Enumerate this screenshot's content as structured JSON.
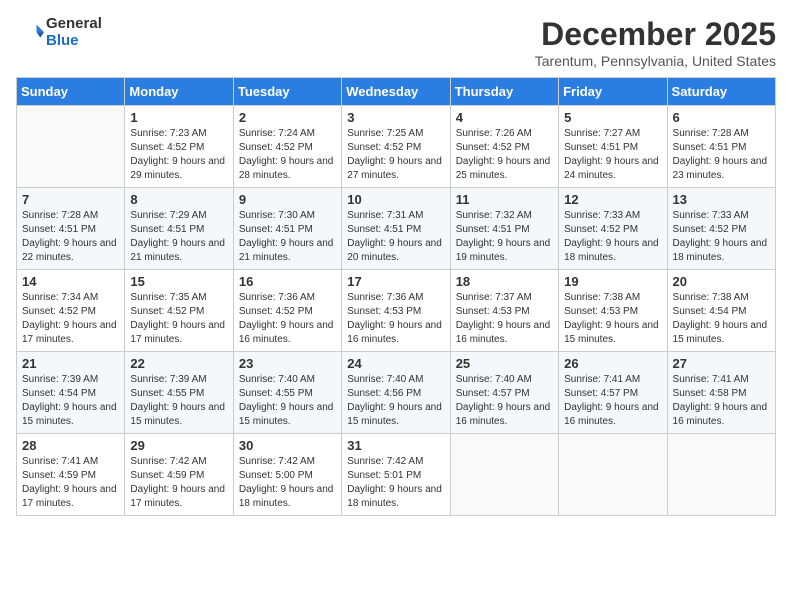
{
  "logo": {
    "general": "General",
    "blue": "Blue"
  },
  "header": {
    "month": "December 2025",
    "location": "Tarentum, Pennsylvania, United States"
  },
  "weekdays": [
    "Sunday",
    "Monday",
    "Tuesday",
    "Wednesday",
    "Thursday",
    "Friday",
    "Saturday"
  ],
  "weeks": [
    [
      {
        "day": "",
        "sunrise": "",
        "sunset": "",
        "daylight": ""
      },
      {
        "day": "1",
        "sunrise": "Sunrise: 7:23 AM",
        "sunset": "Sunset: 4:52 PM",
        "daylight": "Daylight: 9 hours and 29 minutes."
      },
      {
        "day": "2",
        "sunrise": "Sunrise: 7:24 AM",
        "sunset": "Sunset: 4:52 PM",
        "daylight": "Daylight: 9 hours and 28 minutes."
      },
      {
        "day": "3",
        "sunrise": "Sunrise: 7:25 AM",
        "sunset": "Sunset: 4:52 PM",
        "daylight": "Daylight: 9 hours and 27 minutes."
      },
      {
        "day": "4",
        "sunrise": "Sunrise: 7:26 AM",
        "sunset": "Sunset: 4:52 PM",
        "daylight": "Daylight: 9 hours and 25 minutes."
      },
      {
        "day": "5",
        "sunrise": "Sunrise: 7:27 AM",
        "sunset": "Sunset: 4:51 PM",
        "daylight": "Daylight: 9 hours and 24 minutes."
      },
      {
        "day": "6",
        "sunrise": "Sunrise: 7:28 AM",
        "sunset": "Sunset: 4:51 PM",
        "daylight": "Daylight: 9 hours and 23 minutes."
      }
    ],
    [
      {
        "day": "7",
        "sunrise": "Sunrise: 7:28 AM",
        "sunset": "Sunset: 4:51 PM",
        "daylight": "Daylight: 9 hours and 22 minutes."
      },
      {
        "day": "8",
        "sunrise": "Sunrise: 7:29 AM",
        "sunset": "Sunset: 4:51 PM",
        "daylight": "Daylight: 9 hours and 21 minutes."
      },
      {
        "day": "9",
        "sunrise": "Sunrise: 7:30 AM",
        "sunset": "Sunset: 4:51 PM",
        "daylight": "Daylight: 9 hours and 21 minutes."
      },
      {
        "day": "10",
        "sunrise": "Sunrise: 7:31 AM",
        "sunset": "Sunset: 4:51 PM",
        "daylight": "Daylight: 9 hours and 20 minutes."
      },
      {
        "day": "11",
        "sunrise": "Sunrise: 7:32 AM",
        "sunset": "Sunset: 4:51 PM",
        "daylight": "Daylight: 9 hours and 19 minutes."
      },
      {
        "day": "12",
        "sunrise": "Sunrise: 7:33 AM",
        "sunset": "Sunset: 4:52 PM",
        "daylight": "Daylight: 9 hours and 18 minutes."
      },
      {
        "day": "13",
        "sunrise": "Sunrise: 7:33 AM",
        "sunset": "Sunset: 4:52 PM",
        "daylight": "Daylight: 9 hours and 18 minutes."
      }
    ],
    [
      {
        "day": "14",
        "sunrise": "Sunrise: 7:34 AM",
        "sunset": "Sunset: 4:52 PM",
        "daylight": "Daylight: 9 hours and 17 minutes."
      },
      {
        "day": "15",
        "sunrise": "Sunrise: 7:35 AM",
        "sunset": "Sunset: 4:52 PM",
        "daylight": "Daylight: 9 hours and 17 minutes."
      },
      {
        "day": "16",
        "sunrise": "Sunrise: 7:36 AM",
        "sunset": "Sunset: 4:52 PM",
        "daylight": "Daylight: 9 hours and 16 minutes."
      },
      {
        "day": "17",
        "sunrise": "Sunrise: 7:36 AM",
        "sunset": "Sunset: 4:53 PM",
        "daylight": "Daylight: 9 hours and 16 minutes."
      },
      {
        "day": "18",
        "sunrise": "Sunrise: 7:37 AM",
        "sunset": "Sunset: 4:53 PM",
        "daylight": "Daylight: 9 hours and 16 minutes."
      },
      {
        "day": "19",
        "sunrise": "Sunrise: 7:38 AM",
        "sunset": "Sunset: 4:53 PM",
        "daylight": "Daylight: 9 hours and 15 minutes."
      },
      {
        "day": "20",
        "sunrise": "Sunrise: 7:38 AM",
        "sunset": "Sunset: 4:54 PM",
        "daylight": "Daylight: 9 hours and 15 minutes."
      }
    ],
    [
      {
        "day": "21",
        "sunrise": "Sunrise: 7:39 AM",
        "sunset": "Sunset: 4:54 PM",
        "daylight": "Daylight: 9 hours and 15 minutes."
      },
      {
        "day": "22",
        "sunrise": "Sunrise: 7:39 AM",
        "sunset": "Sunset: 4:55 PM",
        "daylight": "Daylight: 9 hours and 15 minutes."
      },
      {
        "day": "23",
        "sunrise": "Sunrise: 7:40 AM",
        "sunset": "Sunset: 4:55 PM",
        "daylight": "Daylight: 9 hours and 15 minutes."
      },
      {
        "day": "24",
        "sunrise": "Sunrise: 7:40 AM",
        "sunset": "Sunset: 4:56 PM",
        "daylight": "Daylight: 9 hours and 15 minutes."
      },
      {
        "day": "25",
        "sunrise": "Sunrise: 7:40 AM",
        "sunset": "Sunset: 4:57 PM",
        "daylight": "Daylight: 9 hours and 16 minutes."
      },
      {
        "day": "26",
        "sunrise": "Sunrise: 7:41 AM",
        "sunset": "Sunset: 4:57 PM",
        "daylight": "Daylight: 9 hours and 16 minutes."
      },
      {
        "day": "27",
        "sunrise": "Sunrise: 7:41 AM",
        "sunset": "Sunset: 4:58 PM",
        "daylight": "Daylight: 9 hours and 16 minutes."
      }
    ],
    [
      {
        "day": "28",
        "sunrise": "Sunrise: 7:41 AM",
        "sunset": "Sunset: 4:59 PM",
        "daylight": "Daylight: 9 hours and 17 minutes."
      },
      {
        "day": "29",
        "sunrise": "Sunrise: 7:42 AM",
        "sunset": "Sunset: 4:59 PM",
        "daylight": "Daylight: 9 hours and 17 minutes."
      },
      {
        "day": "30",
        "sunrise": "Sunrise: 7:42 AM",
        "sunset": "Sunset: 5:00 PM",
        "daylight": "Daylight: 9 hours and 18 minutes."
      },
      {
        "day": "31",
        "sunrise": "Sunrise: 7:42 AM",
        "sunset": "Sunset: 5:01 PM",
        "daylight": "Daylight: 9 hours and 18 minutes."
      },
      {
        "day": "",
        "sunrise": "",
        "sunset": "",
        "daylight": ""
      },
      {
        "day": "",
        "sunrise": "",
        "sunset": "",
        "daylight": ""
      },
      {
        "day": "",
        "sunrise": "",
        "sunset": "",
        "daylight": ""
      }
    ]
  ]
}
